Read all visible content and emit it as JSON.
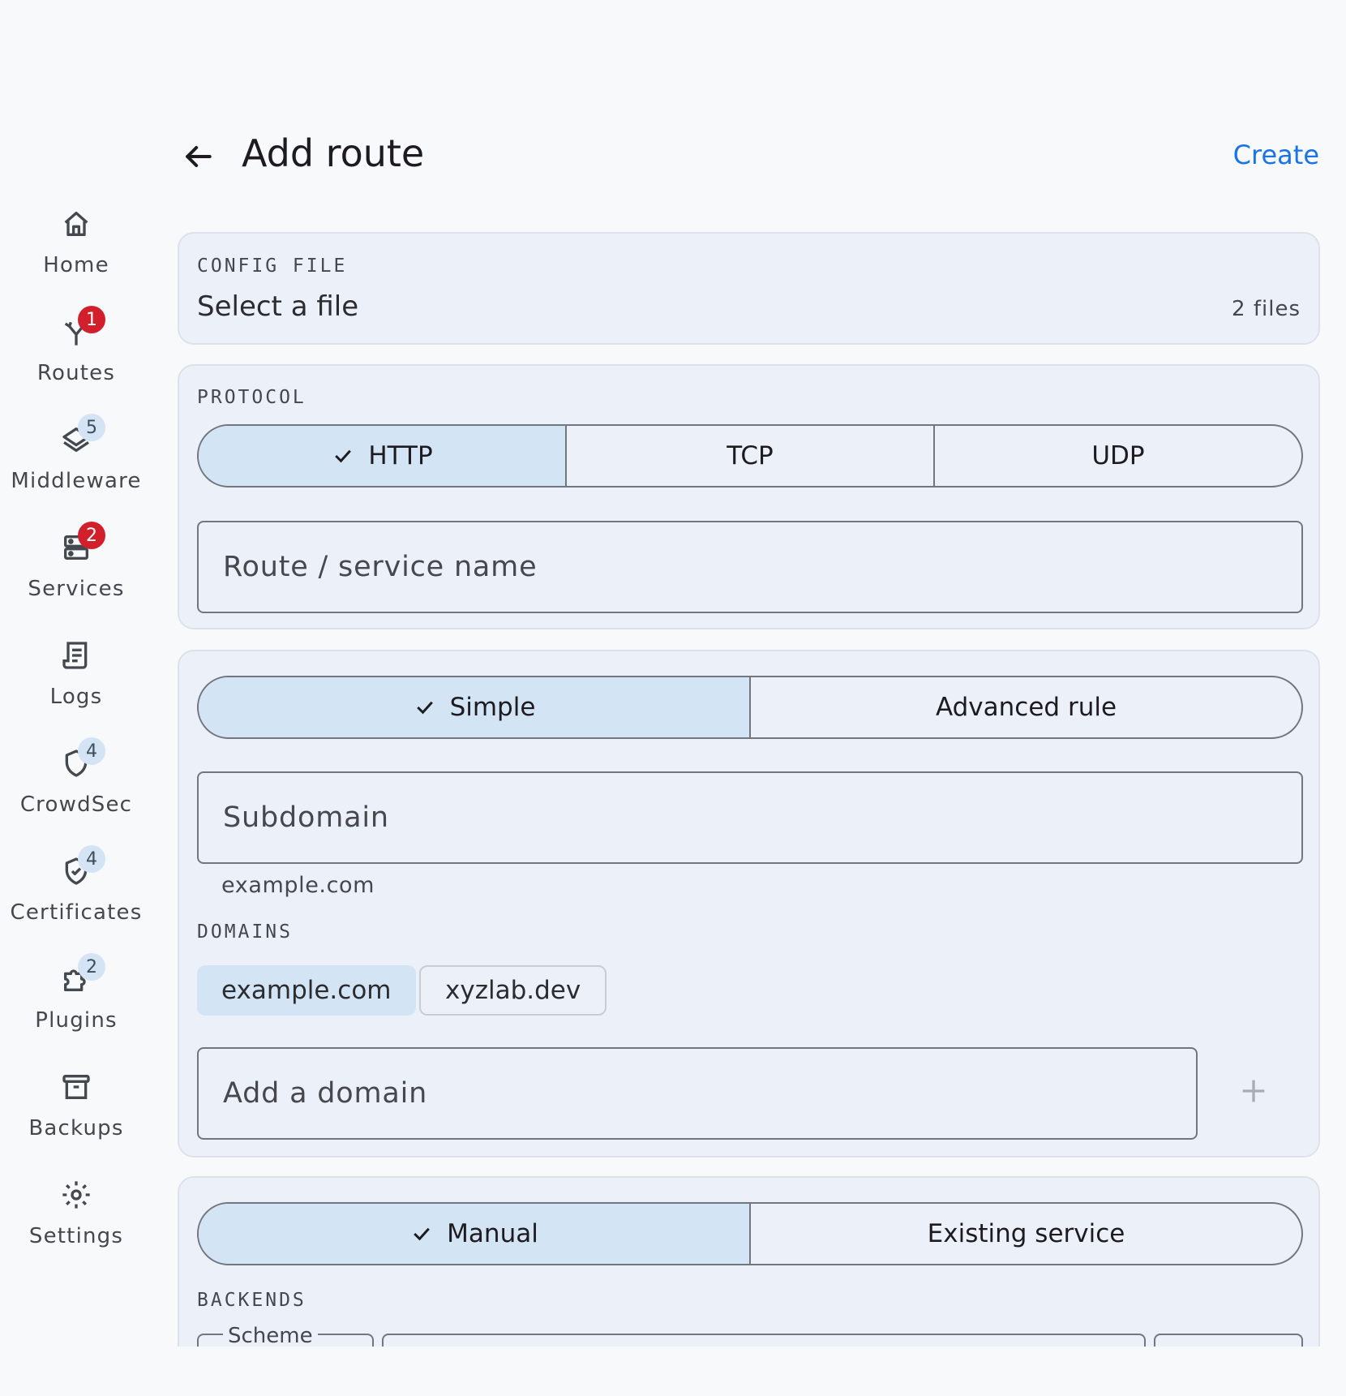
{
  "header": {
    "title": "Add route",
    "create_label": "Create"
  },
  "nav": [
    {
      "id": "home",
      "label": "Home",
      "icon": "home-icon",
      "badge": null
    },
    {
      "id": "routes",
      "label": "Routes",
      "icon": "routes-icon",
      "badge": "1"
    },
    {
      "id": "middleware",
      "label": "Middleware",
      "icon": "layers-icon",
      "badge": "5"
    },
    {
      "id": "services",
      "label": "Services",
      "icon": "server-icon",
      "badge": "2"
    },
    {
      "id": "logs",
      "label": "Logs",
      "icon": "logs-icon",
      "badge": null
    },
    {
      "id": "crowdsec",
      "label": "CrowdSec",
      "icon": "shield-icon",
      "badge": "4"
    },
    {
      "id": "certificates",
      "label": "Certificates",
      "icon": "shield-check-icon",
      "badge": "4"
    },
    {
      "id": "plugins",
      "label": "Plugins",
      "icon": "puzzle-icon",
      "badge": "2"
    },
    {
      "id": "backups",
      "label": "Backups",
      "icon": "archive-icon",
      "badge": null
    },
    {
      "id": "settings",
      "label": "Settings",
      "icon": "gear-icon",
      "badge": null
    }
  ],
  "config_file": {
    "caption": "CONFIG FILE",
    "value": "Select a file",
    "count": "2 files"
  },
  "protocol": {
    "caption": "PROTOCOL",
    "options": [
      "HTTP",
      "TCP",
      "UDP"
    ],
    "selected": "HTTP",
    "name_placeholder": "Route / service name"
  },
  "routing": {
    "modes": [
      "Simple",
      "Advanced rule"
    ],
    "selected": "Simple",
    "subdomain_placeholder": "Subdomain",
    "subdomain_hint": "example.com",
    "domains_caption": "DOMAINS",
    "domains": [
      "example.com",
      "xyzlab.dev"
    ],
    "selected_domain": "example.com",
    "add_domain_placeholder": "Add a domain"
  },
  "backend": {
    "modes": [
      "Manual",
      "Existing service"
    ],
    "selected": "Manual",
    "caption": "BACKENDS",
    "scheme_label": "Scheme"
  },
  "colors": {
    "accent": "#1a73e8",
    "badge_red": "#d21f2c",
    "selected": "#d3e4f4",
    "card": "#ecf0f9"
  }
}
